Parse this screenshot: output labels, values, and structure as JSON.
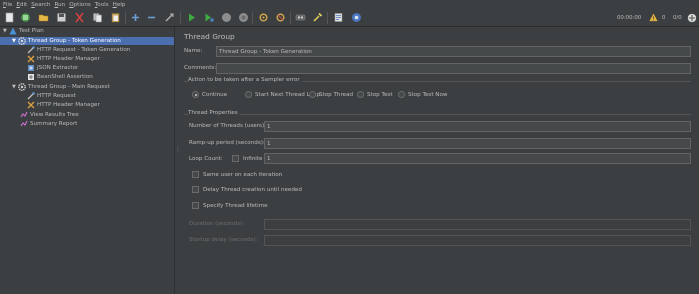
{
  "menu": [
    "File",
    "Edit",
    "Search",
    "Run",
    "Options",
    "Tools",
    "Help"
  ],
  "toolbar": {
    "icons": [
      "new-icon",
      "templates-icon",
      "open-icon",
      "save-icon",
      "cut-icon",
      "copy-icon",
      "paste-icon",
      "expand-icon",
      "collapse-icon",
      "toggle-icon",
      "start-icon",
      "start-no-pauses-icon",
      "stop-icon",
      "shutdown-icon",
      "clear-icon",
      "clear-all-icon",
      "search-icon",
      "reset-search-icon",
      "function-helper-icon",
      "help-icon"
    ],
    "timer": "00:00:00",
    "warning_count": "0",
    "threads_ratio": "0/0"
  },
  "tree": {
    "items": [
      {
        "label": "Test Plan",
        "icon": "testplan-icon",
        "toggle": "▼"
      },
      {
        "label": "Thread Group - Token Generation",
        "icon": "gear-icon",
        "toggle": "▼"
      },
      {
        "label": "HTTP Request - Token Generation",
        "icon": "pipette-icon"
      },
      {
        "label": "HTTP Header Manager",
        "icon": "wrench-icon"
      },
      {
        "label": "JSON Extractor",
        "icon": "extractor-icon"
      },
      {
        "label": "BeanShell Assertion",
        "icon": "assertion-icon"
      },
      {
        "label": "Thread Group - Main Request",
        "icon": "gear-icon",
        "toggle": "▼"
      },
      {
        "label": "HTTP Request",
        "icon": "pipette-icon"
      },
      {
        "label": "HTTP Header Manager",
        "icon": "wrench-icon"
      },
      {
        "label": "View Results Tree",
        "icon": "listener-icon"
      },
      {
        "label": "Summary Report",
        "icon": "listener-icon"
      }
    ]
  },
  "panel": {
    "title": "Thread Group",
    "name_label": "Name:",
    "name_value": "Thread Group - Token Generation",
    "comments_label": "Comments:",
    "comments_value": "",
    "error_action_label": "Action to be taken after a Sampler error",
    "error_actions": [
      "Continue",
      "Start Next Thread Loop",
      "Stop Thread",
      "Stop Test",
      "Stop Test Now"
    ],
    "error_action_selected": 0,
    "props_label": "Thread Properties",
    "threads_label": "Number of Threads (users):",
    "threads_value": "1",
    "rampup_label": "Ramp-up period (seconds):",
    "rampup_value": "1",
    "loop_label": "Loop Count:",
    "infinite_label": "Infinite",
    "loop_value": "1",
    "same_user_label": "Same user on each iteration",
    "delay_label": "Delay Thread creation until needed",
    "lifetime_label": "Specify Thread lifetime",
    "duration_label": "Duration (seconds):",
    "startup_label": "Startup delay (seconds):"
  }
}
